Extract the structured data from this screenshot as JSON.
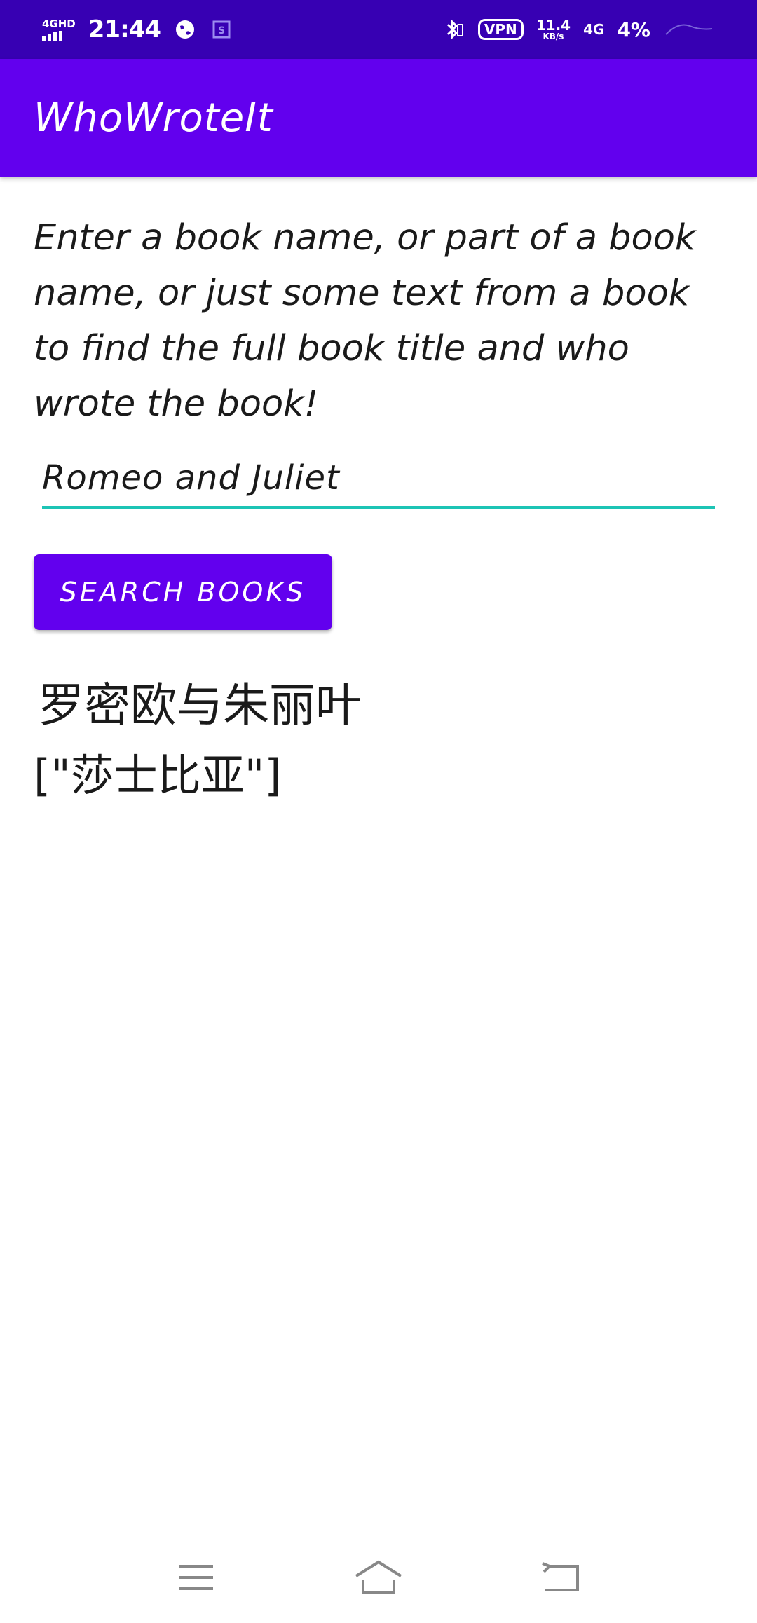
{
  "status_bar": {
    "network_label": "4GHD",
    "time": "21:44",
    "vpn_label": "VPN",
    "speed_value": "11.4",
    "speed_unit": "KB/s",
    "network_type": "4G",
    "battery": "4%"
  },
  "app_bar": {
    "title": "WhoWroteIt"
  },
  "main": {
    "instructions": "Enter a book name, or part of a book name, or just some text from a book to find the full book title and who wrote the book!",
    "search_input_value": "Romeo and Juliet",
    "search_button_label": "SEARCH BOOKS",
    "result_title": "罗密欧与朱丽叶",
    "result_author": "[\"莎士比亚\"]"
  },
  "nav_bar": {
    "icons": [
      "menu-icon",
      "home-icon",
      "back-icon"
    ]
  },
  "colors": {
    "status_bar": "#3700B3",
    "primary": "#6200EE",
    "accent": "#1DC4B5",
    "text": "#1a1a1a"
  }
}
